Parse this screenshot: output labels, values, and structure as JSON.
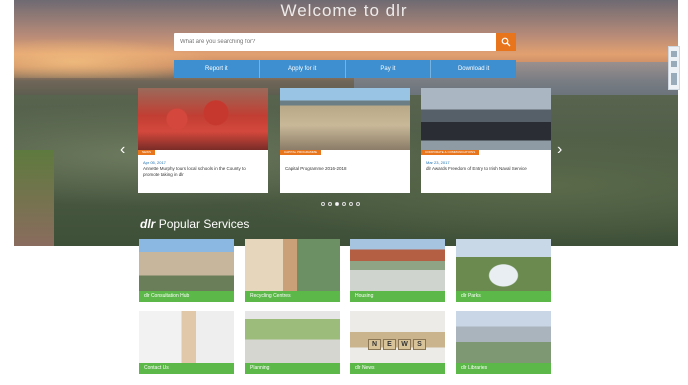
{
  "header": {
    "title": "Welcome to dlr"
  },
  "search": {
    "placeholder": "What are you searching for?",
    "button_icon": "search-icon"
  },
  "quick_links": [
    "Report it",
    "Apply for it",
    "Pay it",
    "Download it"
  ],
  "carousel": {
    "cards": [
      {
        "tag": "NEWS",
        "date": "Apr 05, 2017",
        "text": "Annette Murphy tours local schools in the County to promote taking in dlr"
      },
      {
        "tag": "CAPITAL PROGRAMME",
        "date": "",
        "text": "Capital Programme 2016-2018"
      },
      {
        "tag": "CORPORATE & COMMUNICATIONS",
        "date": "Mar 23, 2017",
        "text": "dlr Awards Freedom of Entry to Irish Naval Service"
      }
    ],
    "dots_count": 6,
    "active_dot": 2
  },
  "popular": {
    "brand": "dlr",
    "title": "Popular Services",
    "tiles": [
      "dlr Consultation Hub",
      "Recycling Centres",
      "Housing",
      "dlr Parks",
      "Contact Us",
      "Planning",
      "dlr News",
      "dlr Libraries"
    ],
    "news_letters": [
      "N",
      "E",
      "W",
      "S"
    ]
  },
  "colors": {
    "accent": "#e8741c",
    "quick_blue": "#3d8fd0",
    "tile_green": "#5cb849"
  }
}
